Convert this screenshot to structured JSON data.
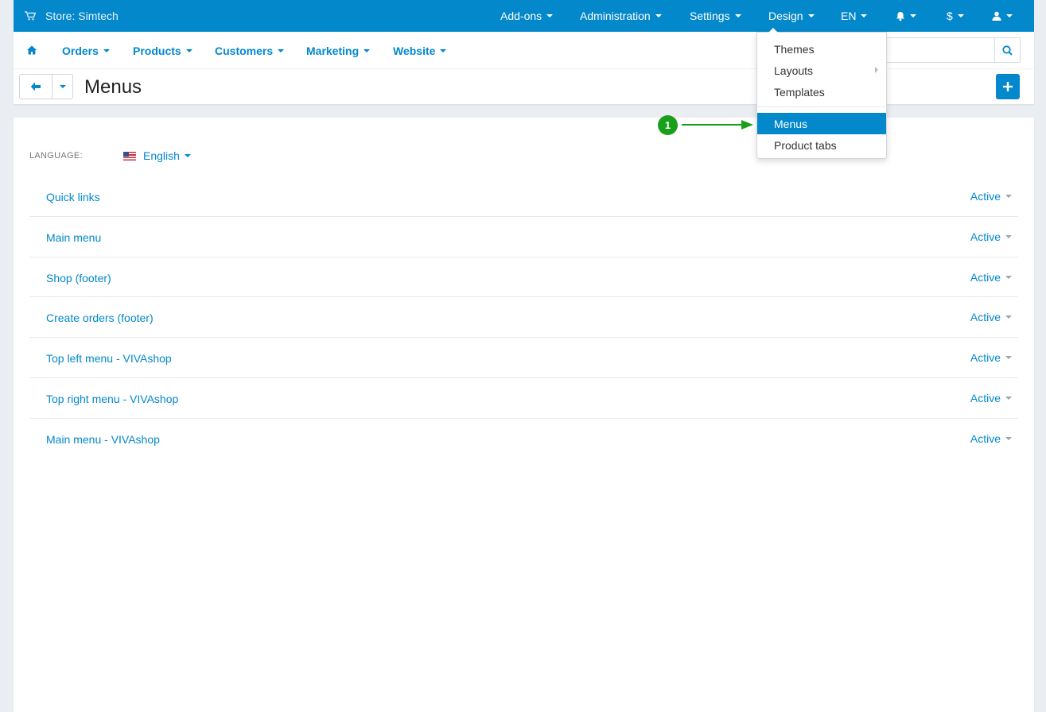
{
  "topbar": {
    "store_label": "Store: Simtech",
    "menu": [
      {
        "label": "Add-ons"
      },
      {
        "label": "Administration"
      },
      {
        "label": "Settings"
      },
      {
        "label": "Design"
      },
      {
        "label": "EN"
      },
      {
        "label": ""
      },
      {
        "label": "$"
      },
      {
        "label": ""
      }
    ]
  },
  "nav": {
    "items": [
      {
        "label": "Orders"
      },
      {
        "label": "Products"
      },
      {
        "label": "Customers"
      },
      {
        "label": "Marketing"
      },
      {
        "label": "Website"
      }
    ],
    "search_placeholder": ""
  },
  "page": {
    "title": "Menus"
  },
  "language": {
    "label": "LANGUAGE:",
    "selected": "English"
  },
  "menus": [
    {
      "name": "Quick links",
      "status": "Active"
    },
    {
      "name": "Main menu",
      "status": "Active"
    },
    {
      "name": "Shop (footer)",
      "status": "Active"
    },
    {
      "name": "Create orders (footer)",
      "status": "Active"
    },
    {
      "name": "Top left menu - VIVAshop",
      "status": "Active"
    },
    {
      "name": "Top right menu - VIVAshop",
      "status": "Active"
    },
    {
      "name": "Main menu - VIVAshop",
      "status": "Active"
    }
  ],
  "design_dropdown": {
    "items": [
      {
        "label": "Themes"
      },
      {
        "label": "Layouts"
      },
      {
        "label": "Templates"
      },
      {
        "label": "Menus"
      },
      {
        "label": "Product tabs"
      }
    ]
  },
  "annotation": {
    "step": "1"
  },
  "colors": {
    "primary": "#0388cc",
    "annotation": "#1a9f1a"
  }
}
